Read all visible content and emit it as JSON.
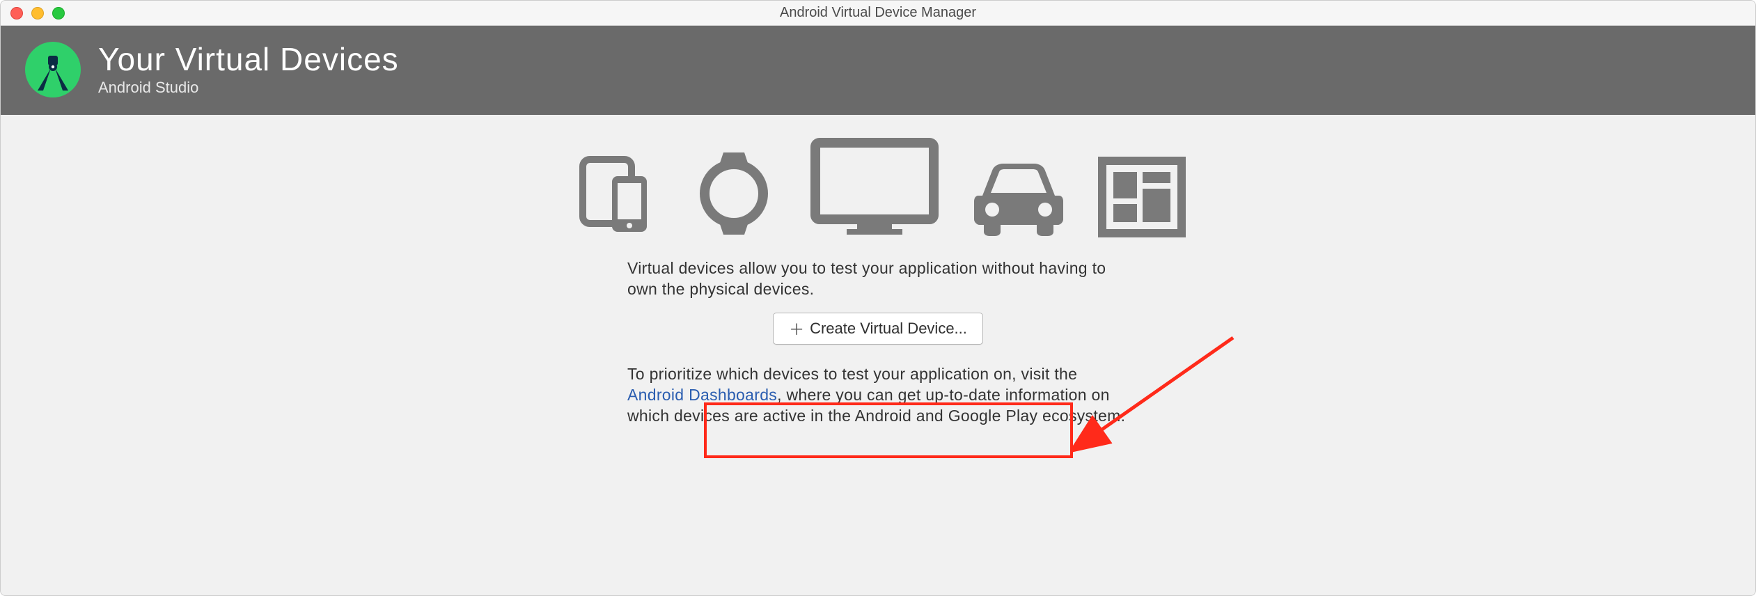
{
  "window": {
    "title": "Android Virtual Device Manager"
  },
  "header": {
    "title": "Your Virtual Devices",
    "subtitle": "Android Studio"
  },
  "main": {
    "intro": "Virtual devices allow you to test your application without having to own the physical devices.",
    "create_button_label": "Create Virtual Device...",
    "footer_pre": "To prioritize which devices to test your application on, visit the ",
    "footer_link": "Android Dashboards",
    "footer_post": ", where you can get up-to-date information on which devices are active in the Android and Google Play ecosystem."
  },
  "icons": {
    "phone_tablet": "phone-tablet-icon",
    "watch": "watch-icon",
    "tv": "tv-icon",
    "car": "car-icon",
    "dashboard": "dashboard-icon"
  },
  "colors": {
    "header_bg": "#6a6a6a",
    "icon_gray": "#7a7a7a",
    "annotation_red": "#ff2a1a",
    "link_blue": "#2a5db0"
  }
}
